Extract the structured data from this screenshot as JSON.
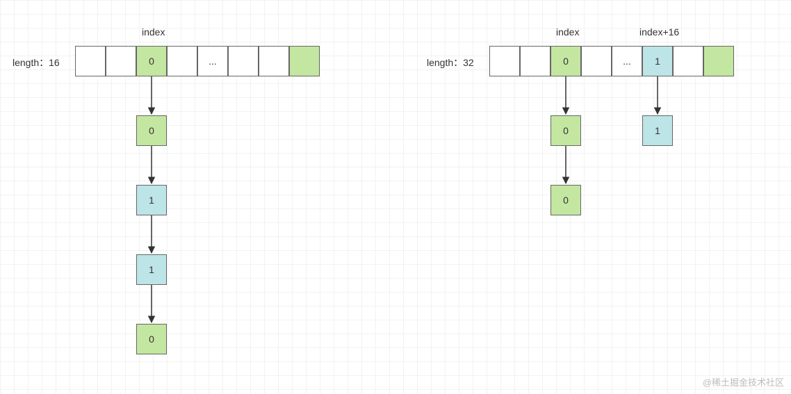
{
  "left": {
    "lengthLabel": "length：16",
    "indexLabel": "index",
    "cells": [
      {
        "val": "",
        "cls": ""
      },
      {
        "val": "",
        "cls": ""
      },
      {
        "val": "0",
        "cls": "green"
      },
      {
        "val": "",
        "cls": ""
      },
      {
        "val": "...",
        "cls": ""
      },
      {
        "val": "",
        "cls": ""
      },
      {
        "val": "",
        "cls": ""
      },
      {
        "val": "",
        "cls": "green"
      }
    ],
    "chain": [
      {
        "val": "0",
        "cls": "green"
      },
      {
        "val": "1",
        "cls": "blue"
      },
      {
        "val": "1",
        "cls": "blue"
      },
      {
        "val": "0",
        "cls": "green"
      }
    ]
  },
  "right": {
    "lengthLabel": "length：32",
    "indexLabel": "index",
    "index16Label": "index+16",
    "cells": [
      {
        "val": "",
        "cls": ""
      },
      {
        "val": "",
        "cls": ""
      },
      {
        "val": "0",
        "cls": "green"
      },
      {
        "val": "",
        "cls": ""
      },
      {
        "val": "...",
        "cls": ""
      },
      {
        "val": "1",
        "cls": "blue"
      },
      {
        "val": "",
        "cls": ""
      },
      {
        "val": "",
        "cls": "green"
      }
    ],
    "chainA": [
      {
        "val": "0",
        "cls": "green"
      },
      {
        "val": "0",
        "cls": "green"
      }
    ],
    "chainB": [
      {
        "val": "1",
        "cls": "blue"
      }
    ]
  },
  "watermark": "@稀土掘金技术社区"
}
